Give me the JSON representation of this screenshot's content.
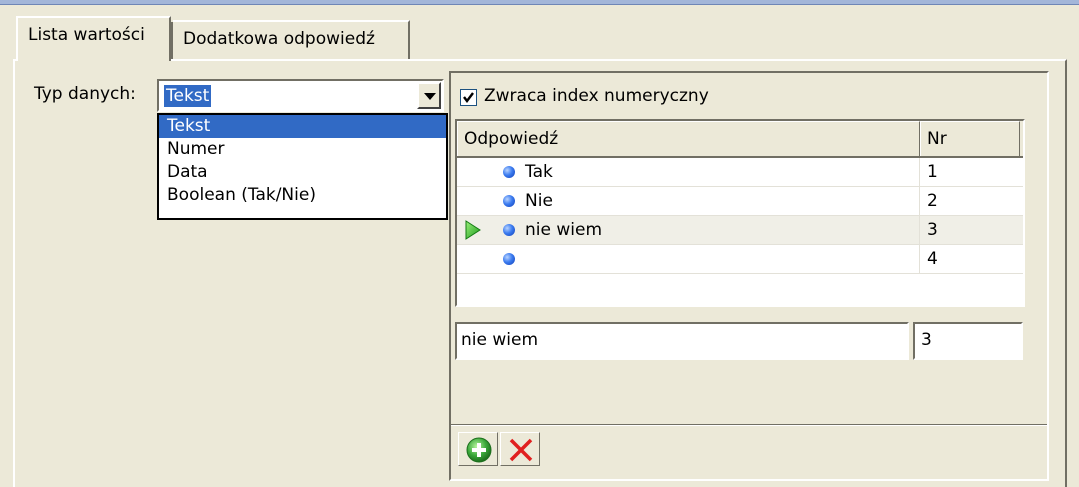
{
  "tabs": [
    {
      "label": "Lista wartości",
      "active": true
    },
    {
      "label": "Dodatkowa odpowiedź",
      "active": false
    }
  ],
  "data_type": {
    "label": "Typ danych:",
    "selected": "Tekst",
    "options": [
      "Tekst",
      "Numer",
      "Data",
      "Boolean (Tak/Nie)"
    ]
  },
  "numeric_index": {
    "label": "Zwraca index numeryczny",
    "checked": true
  },
  "grid": {
    "headers": {
      "answer": "Odpowiedź",
      "nr": "Nr"
    },
    "rows": [
      {
        "answer": "Tak",
        "nr": "1"
      },
      {
        "answer": "Nie",
        "nr": "2"
      },
      {
        "answer": "nie wiem",
        "nr": "3",
        "current": true
      },
      {
        "answer": "",
        "nr": "4"
      }
    ]
  },
  "editor": {
    "answer_value": "nie wiem",
    "nr_value": "3"
  },
  "toolbar": {
    "add_icon": "add-icon",
    "delete_icon": "delete-icon"
  },
  "colors": {
    "selection": "#316ac5",
    "face": "#ece9d8",
    "delete": "#e02020",
    "add": "#2a9a2a"
  }
}
